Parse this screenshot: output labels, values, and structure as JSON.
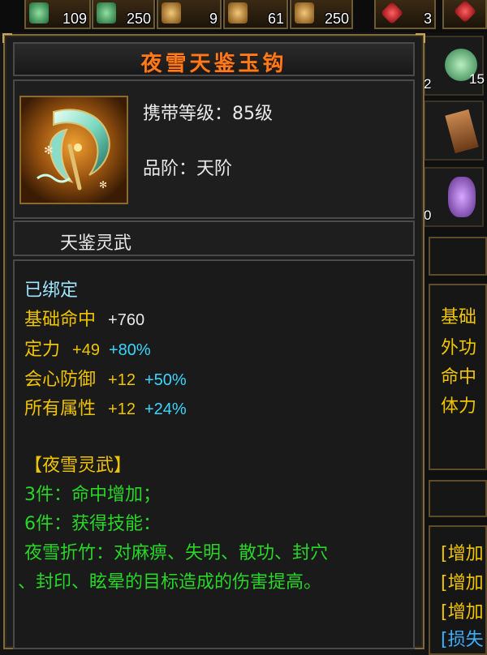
{
  "inventory_top": [
    {
      "count": "109",
      "icon": "jade-potion-icon"
    },
    {
      "count": "250",
      "icon": "jade-potion-icon"
    },
    {
      "count": "9",
      "icon": "gold-ore-icon"
    },
    {
      "count": "61",
      "icon": "gold-ore-icon"
    },
    {
      "count": "250",
      "icon": "gold-ore-icon"
    },
    {
      "count": "3",
      "icon": "red-gem-icon"
    },
    {
      "count": "",
      "icon": "red-gem-icon"
    }
  ],
  "right_inventory": [
    {
      "count": "2",
      "icon": "jade-ring-icon"
    },
    {
      "count": "",
      "icon": "scroll-icon"
    },
    {
      "count": "0",
      "icon": "purple-charm-icon"
    }
  ],
  "right_inventory_extra": {
    "count": "15"
  },
  "background_panel": {
    "lines": [
      {
        "text": "基础",
        "color": "#f0c400"
      },
      {
        "text": "外功",
        "color": "#f0c400"
      },
      {
        "text": "命中",
        "color": "#f0c400"
      },
      {
        "text": "体力",
        "color": "#f0c400"
      }
    ],
    "bonus_lines": [
      {
        "text": "[增加",
        "color": "#f0c400"
      },
      {
        "text": "[增加",
        "color": "#f0c400"
      },
      {
        "text": "[增加",
        "color": "#f0c400"
      },
      {
        "text": "[损失",
        "color": "#3ab0ff"
      }
    ]
  },
  "item": {
    "name": "夜雪天鉴玉钩",
    "name_color": "#ff7a1a",
    "icon": "jade-hook-weapon-icon",
    "level_req": "携带等级：85级",
    "grade": "品阶：天阶",
    "subtype": "天鉴灵武",
    "bound": "已绑定",
    "stats": [
      {
        "name": "基础命中",
        "base": "+760",
        "pct": ""
      },
      {
        "name": "定力",
        "base": "+49",
        "pct": "+80%"
      },
      {
        "name": "会心防御",
        "base": "+12",
        "pct": "+50%"
      },
      {
        "name": "所有属性",
        "base": "+12",
        "pct": "+24%"
      }
    ],
    "set_name": "【夜雪灵武】",
    "set_bonus_3": "3件：命中增加；",
    "set_bonus_6": "6件：获得技能：",
    "skill_line1": "夜雪折竹：对麻痹、失明、散功、封穴",
    "skill_line2": "、封印、眩晕的目标造成的伤害提高。"
  },
  "colors": {
    "bound": "#9ee6ff",
    "stat_name_yellow": "#f0c400",
    "stat_name_white": "#e8e8e8",
    "stat_base": "#e8e8e8",
    "stat_pct": "#3ad6ff",
    "set_name": "#f0c400",
    "set_bonus": "#28d628",
    "frame": "#7d6a3f"
  }
}
